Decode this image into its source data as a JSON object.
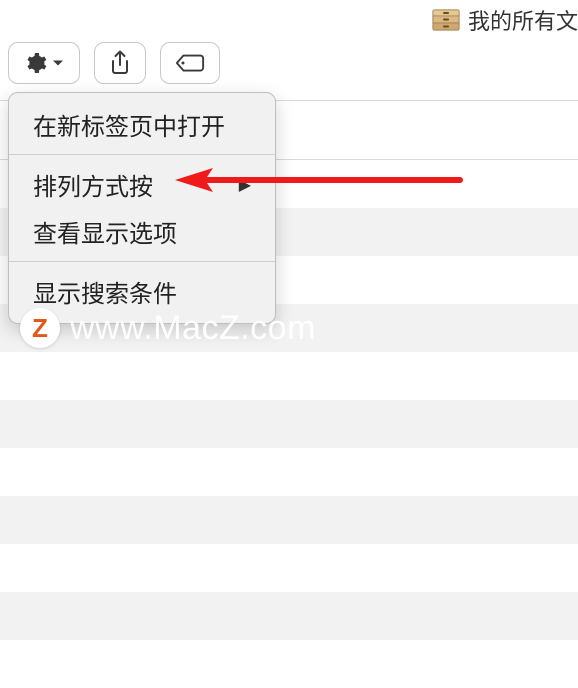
{
  "title": "我的所有文",
  "toolbar": {
    "gear_label": "",
    "share_label": "",
    "tag_label": ""
  },
  "menu": {
    "open_in_new_tab": "在新标签页中打开",
    "sort_by": "排列方式按",
    "view_options": "查看显示选项",
    "show_search_criteria": "显示搜索条件"
  },
  "watermark": {
    "badge": "Z",
    "text": "www.MacZ.com"
  },
  "icons": {
    "drawer": "drawer-icon",
    "gear": "gear-icon",
    "chevron_down": "chevron-down-icon",
    "share": "share-icon",
    "tag": "tag-icon",
    "submenu": "▶"
  }
}
